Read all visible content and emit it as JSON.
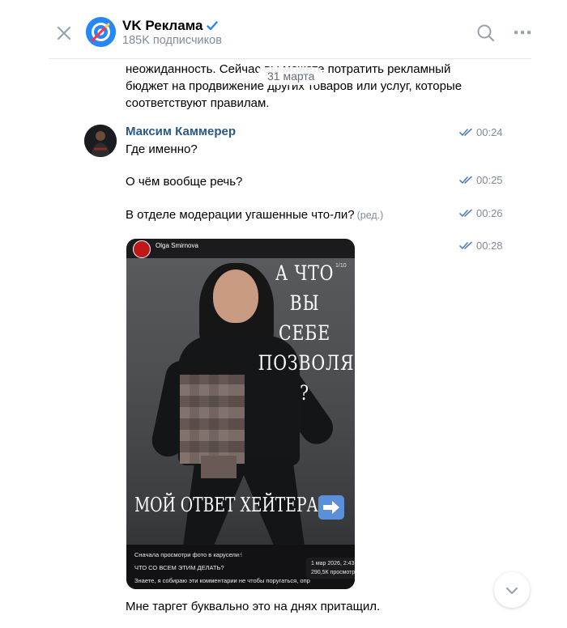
{
  "header": {
    "channel_name": "VK Реклама",
    "subscribers": "185K подписчиков"
  },
  "date_separator": "31 марта",
  "previous_message": {
    "text": "неожиданность. Сейчас вы можете потратить рекламный бюджет на продвижение других товаров или услуг, которые соответствуют правилам."
  },
  "messages": [
    {
      "author": "Максим Каммерер",
      "text": "Где именно?",
      "time": "00:24"
    },
    {
      "text": "О чём вообще речь?",
      "time": "00:25"
    },
    {
      "text": "В отделе модерации угашенные что-ли?",
      "edited": "(ред.)",
      "time": "00:26"
    },
    {
      "type": "image",
      "time": "00:28"
    },
    {
      "text": "Мне таргет буквально это на днях притащил."
    }
  ],
  "post_image": {
    "username": "Olga Smirnova",
    "counter": "1/10",
    "heading_lines": [
      "А ЧТО ВЫ",
      "СЕБЕ",
      "ПОЗВОЛЯЕТЕ ?"
    ],
    "bottom_text": "МОЙ ОТВЕТ ХЕЙТЕРАМ",
    "caption_lines": [
      "Сначала просмотри фото в карусели☝",
      "ЧТО СО ВСЕМ ЭТИМ ДЕЛАТЬ?",
      "Знаете, я собираю эти комментарии не чтобы поругаться, опр"
    ],
    "stamp_date": "1 мар 2026, 2:43",
    "stamp_views": "290,5К просмотр"
  },
  "colors": {
    "accent": "#2a5885",
    "vk_blue": "#2787f5",
    "meta": "#818c99",
    "read_check": "#5181b8"
  }
}
